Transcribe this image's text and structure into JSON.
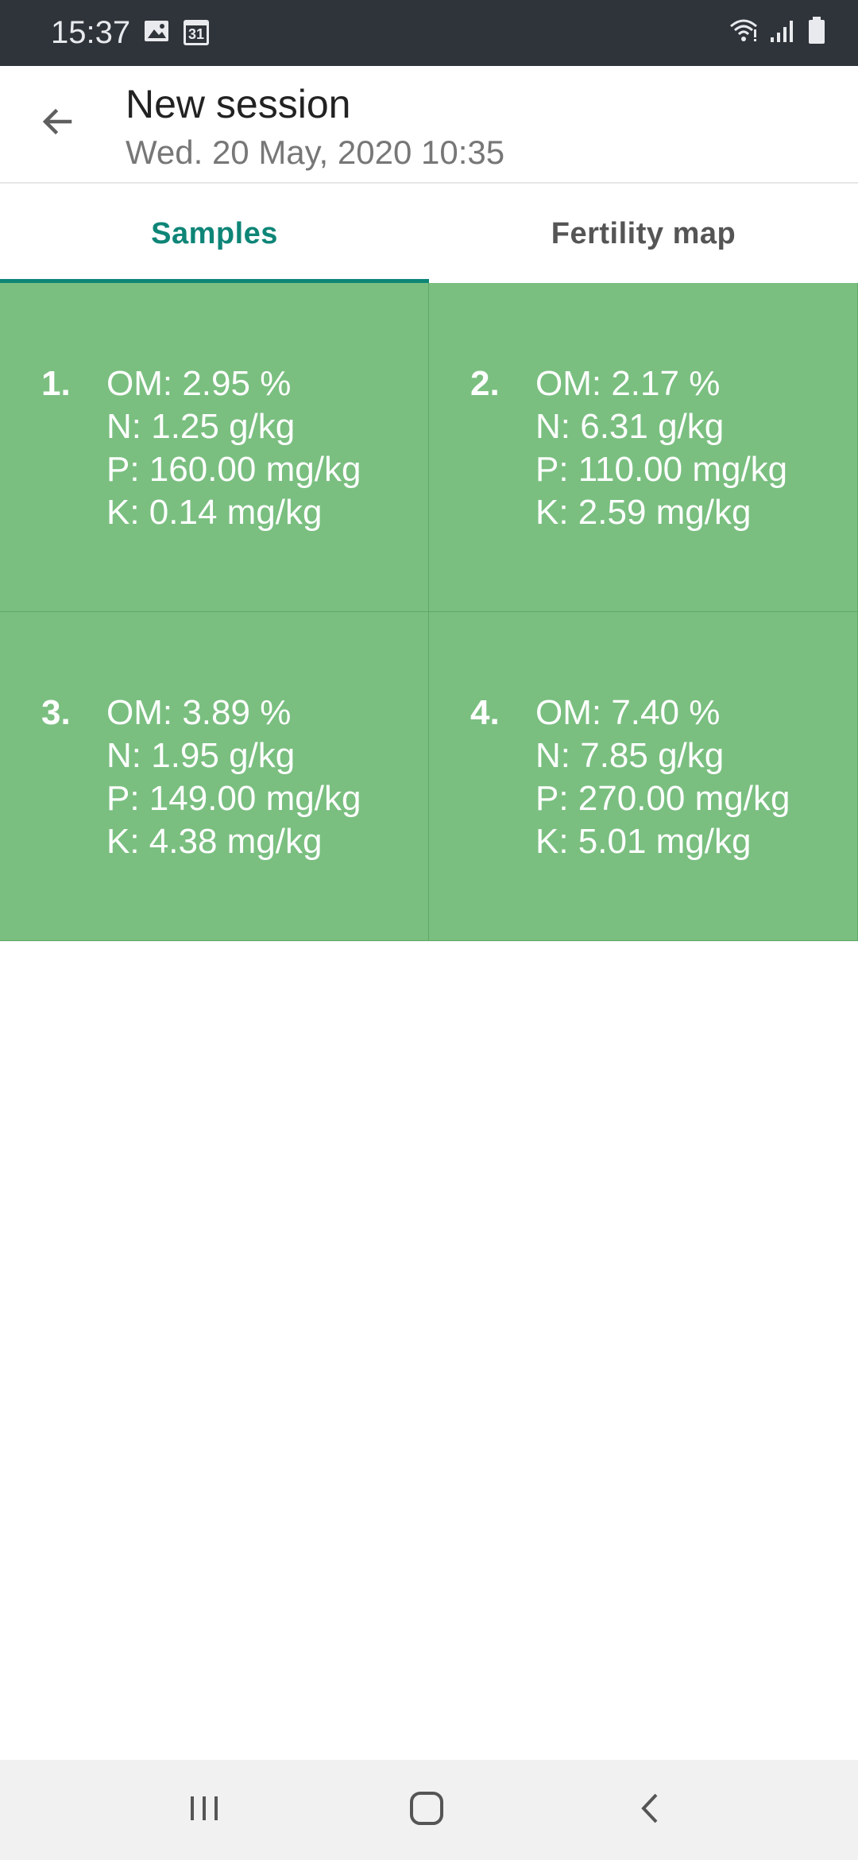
{
  "status_bar": {
    "time": "15:37",
    "calendar_day": "31",
    "icons": [
      "gallery-icon",
      "calendar-icon",
      "wifi-icon",
      "signal-icon",
      "battery-icon"
    ]
  },
  "app_bar": {
    "title": "New session",
    "subtitle": "Wed. 20 May, 2020 10:35"
  },
  "tabs": [
    {
      "label": "Samples",
      "active": true
    },
    {
      "label": "Fertility map",
      "active": false
    }
  ],
  "samples": [
    {
      "number": "1.",
      "om": "OM: 2.95 %",
      "n": "N: 1.25 g/kg",
      "p": "P: 160.00 mg/kg",
      "k": "K: 0.14 mg/kg"
    },
    {
      "number": "2.",
      "om": "OM: 2.17 %",
      "n": "N: 6.31 g/kg",
      "p": "P: 110.00 mg/kg",
      "k": "K: 2.59 mg/kg"
    },
    {
      "number": "3.",
      "om": "OM: 3.89 %",
      "n": "N: 1.95 g/kg",
      "p": "P: 149.00 mg/kg",
      "k": "K: 4.38 mg/kg"
    },
    {
      "number": "4.",
      "om": "OM: 7.40 %",
      "n": "N: 7.85 g/kg",
      "p": "P: 270.00 mg/kg",
      "k": "K: 5.01 mg/kg"
    }
  ],
  "colors": {
    "status_bar": "#2f343b",
    "accent": "#0e8577",
    "sample_cell": "#7abf80"
  },
  "nav_bar": {
    "icons": [
      "recent-apps-icon",
      "home-icon",
      "back-nav-icon"
    ]
  }
}
